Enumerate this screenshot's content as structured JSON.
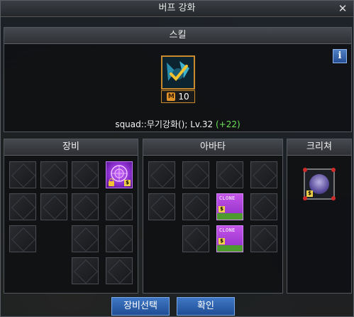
{
  "window": {
    "title": "버프 강화",
    "close_symbol": "✕"
  },
  "skill": {
    "header": "스킬",
    "info_symbol": "i",
    "mastery_badge": "M",
    "level": "10",
    "squad_text": "squad::무기강화(); Lv.32",
    "bonus_text": "(+22)"
  },
  "equipment": {
    "header": "장비"
  },
  "avatar": {
    "header": "아바타",
    "clone_label": "CLONE"
  },
  "creature": {
    "header": "크리쳐"
  },
  "buttons": {
    "select_equipment": "장비선택",
    "confirm": "확인"
  },
  "colors": {
    "accent_blue": "#2f62ad",
    "bonus_green": "#6ee05a",
    "rare_purple": "#8b2fcf",
    "skill_border": "#c88a2a"
  }
}
